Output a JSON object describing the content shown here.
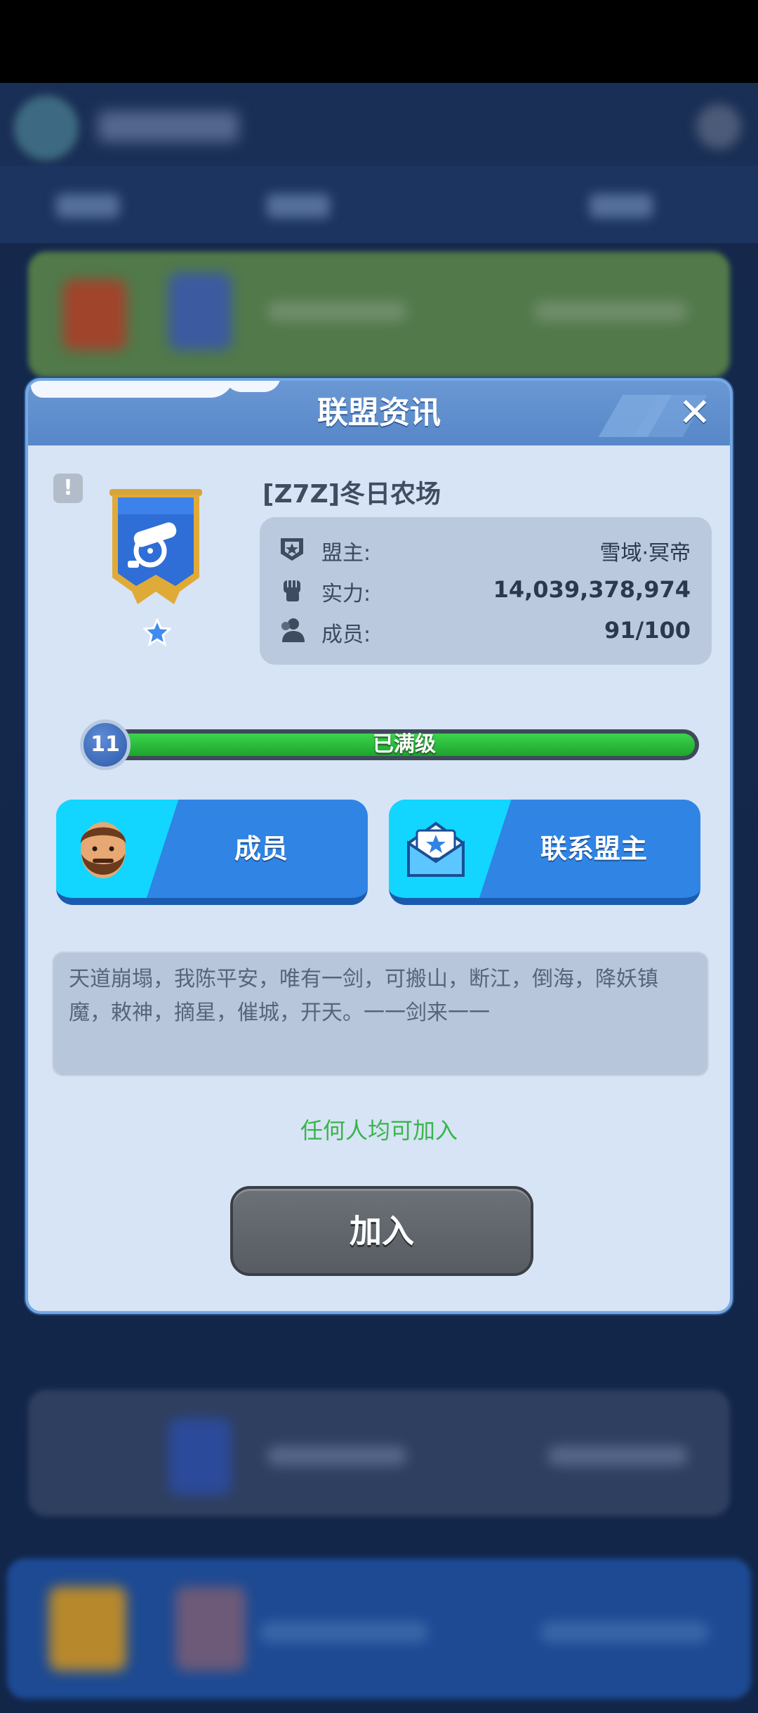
{
  "dialog": {
    "title": "联盟资讯",
    "close_symbol": "✕",
    "report_symbol": "!",
    "alliance_name": "[Z7Z]冬日农场",
    "info": [
      {
        "icon": "leader-icon",
        "label": "盟主:",
        "value": "雪域·冥帝"
      },
      {
        "icon": "power-fist-icon",
        "label": "实力:",
        "value": "14,039,378,974"
      },
      {
        "icon": "members-icon",
        "label": "成员:",
        "value": "91/100"
      }
    ],
    "level": {
      "number": "11",
      "status": "已满级",
      "progress": 1.0
    },
    "members_button": "成员",
    "contact_button": "联系盟主",
    "description": "天道崩塌，我陈平安，唯有一剑，可搬山，断江，倒海，降妖镇魔，敕神，摘星，催城，开天。一一剑来一一",
    "join_hint": "任何人均可加入",
    "join_button": "加入"
  },
  "colors": {
    "dialog_bg": "#d7e4f5",
    "header": "#5f8fcf",
    "primary_button": "#2f84e4",
    "join_hint": "#38b54a",
    "join_button": "#62676e",
    "level_fill": "#2cc23c"
  }
}
